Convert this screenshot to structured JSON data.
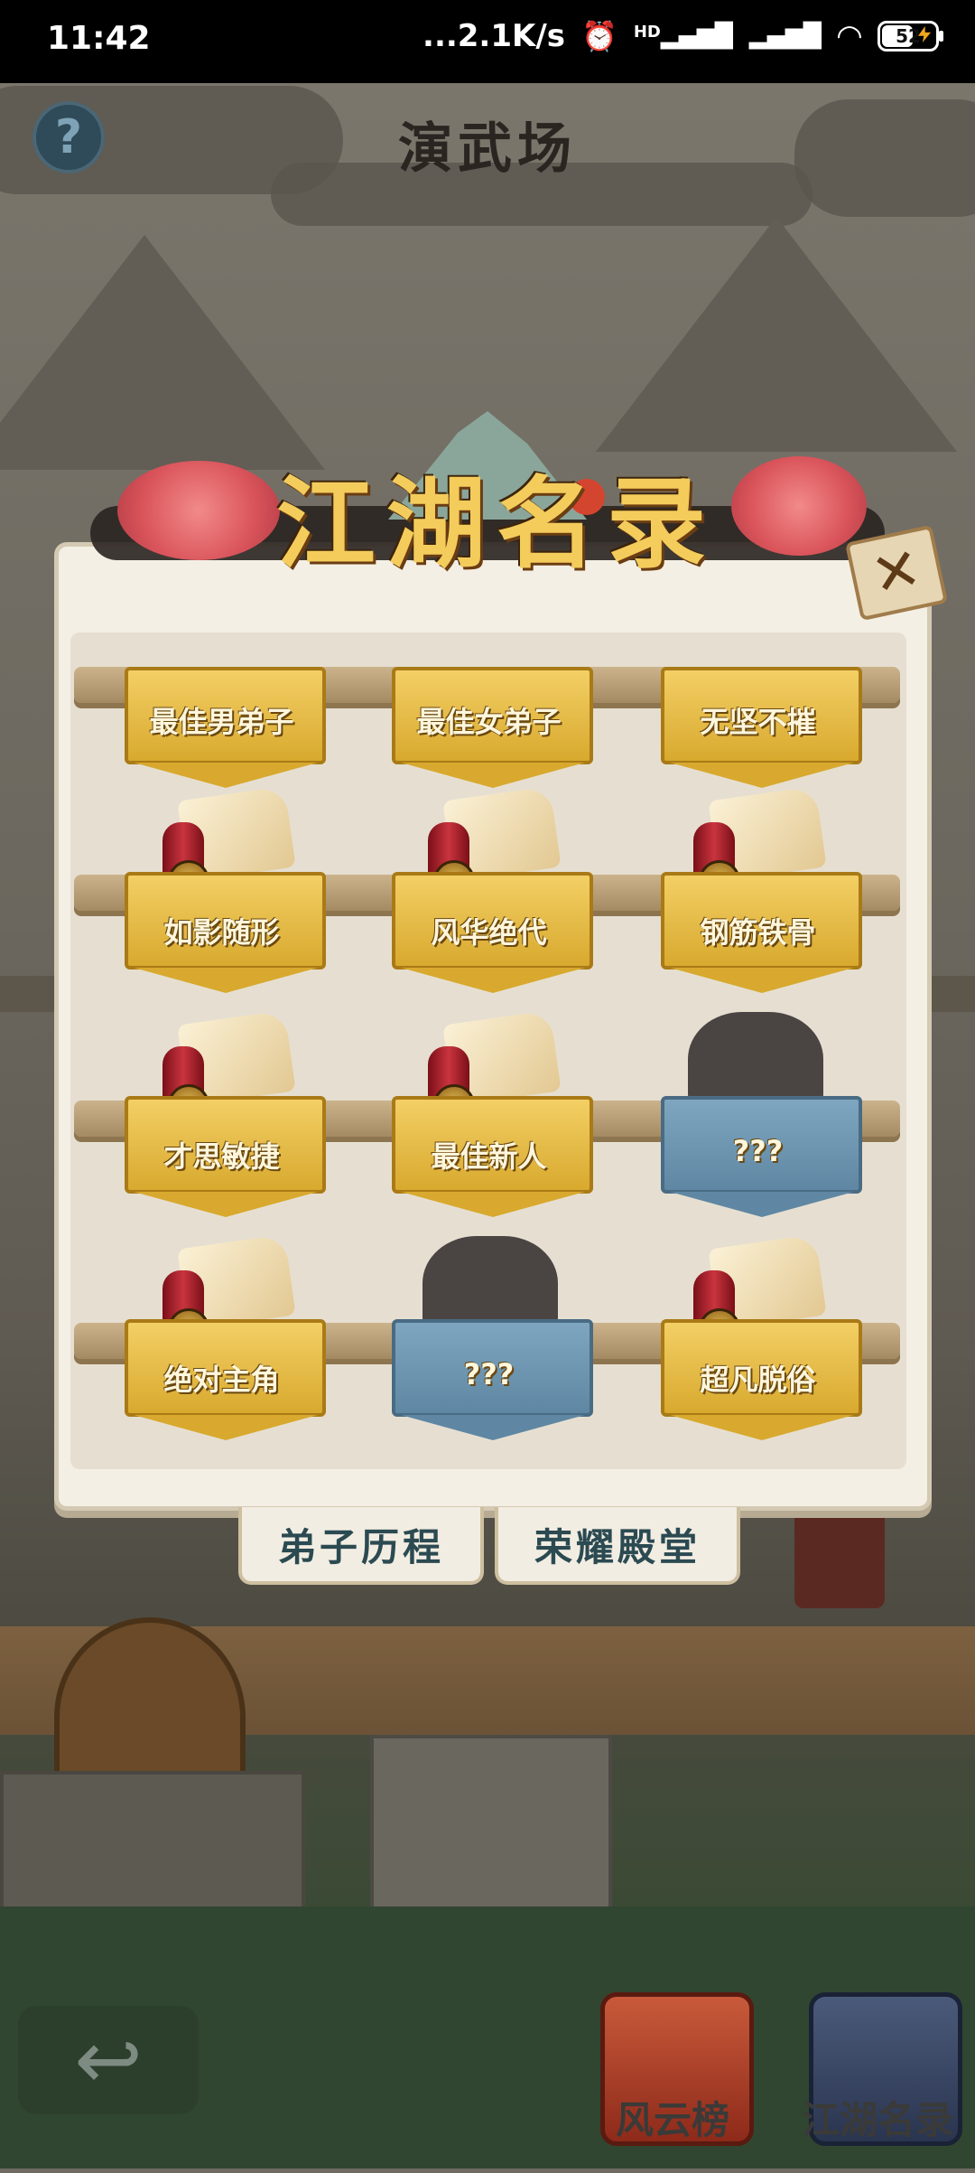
{
  "status_bar": {
    "time": "11:42",
    "network_speed": "...2.1K/s",
    "signal_hd": "HD",
    "battery_level": "52"
  },
  "scene": {
    "title": "演武场",
    "help_icon": "?"
  },
  "modal": {
    "title": "江湖名录",
    "close_icon": "✕",
    "badges": [
      {
        "label": "最佳男弟子",
        "locked": false
      },
      {
        "label": "最佳女弟子",
        "locked": false
      },
      {
        "label": "无坚不摧",
        "locked": false
      },
      {
        "label": "如影随形",
        "locked": false
      },
      {
        "label": "风华绝代",
        "locked": false
      },
      {
        "label": "钢筋铁骨",
        "locked": false
      },
      {
        "label": "才思敏捷",
        "locked": false
      },
      {
        "label": "最佳新人",
        "locked": false
      },
      {
        "label": "???",
        "locked": true
      },
      {
        "label": "绝对主角",
        "locked": false
      },
      {
        "label": "???",
        "locked": true
      },
      {
        "label": "超凡脱俗",
        "locked": false
      }
    ]
  },
  "tabs": {
    "disciple_history": "弟子历程",
    "hall_of_glory": "荣耀殿堂"
  },
  "bottom_bar": {
    "back_icon": "↩",
    "ranking": "风云榜",
    "directory": "江湖名录"
  }
}
